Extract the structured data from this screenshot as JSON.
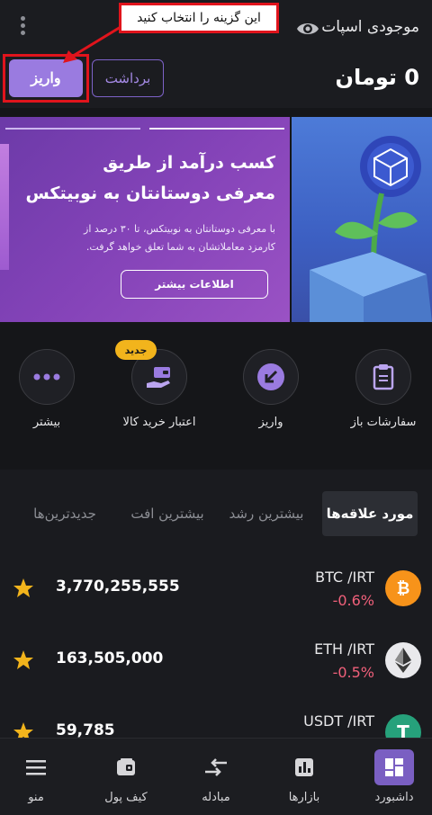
{
  "header": {
    "balance_label": "موجودی اسپات",
    "balance_amount": "0 تومان",
    "deposit_label": "واریز",
    "withdraw_label": "برداشت"
  },
  "annotation": {
    "instruction": "این گزینه را انتخاب کنید",
    "color": "#e0141c"
  },
  "banner": {
    "title_line1": "کسب درآمد از طریق",
    "title_line2": "معرفی دوستانتان به نوبیتکس",
    "desc_line1": "با معرفی دوستانتان به نوبیتکس، تا ۳۰ درصد از",
    "desc_line2": "کارمزد معاملاتشان به شما تعلق خواهد گرفت.",
    "button_label": "اطلاعات بیشتر"
  },
  "quick_actions": [
    {
      "label": "سفارشات باز",
      "icon": "clipboard-icon"
    },
    {
      "label": "واریز",
      "icon": "deposit-arrow-icon"
    },
    {
      "label": "اعتبار خرید کالا",
      "icon": "wallet-hand-icon",
      "badge": "جدید"
    },
    {
      "label": "بیشتر",
      "icon": "more-dots-icon"
    }
  ],
  "market_tabs": [
    {
      "label": "مورد علاقه‌ها",
      "active": true
    },
    {
      "label": "بیشترین رشد",
      "active": false
    },
    {
      "label": "بیشترین افت",
      "active": false
    },
    {
      "label": "جدیدترین‌ها",
      "active": false
    }
  ],
  "coins": [
    {
      "pair": "BTC /IRT",
      "change": "-0.6%",
      "price": "3,770,255,555",
      "icon": "bitcoin-icon",
      "color": "#f7931a"
    },
    {
      "pair": "ETH /IRT",
      "change": "-0.5%",
      "price": "163,505,000",
      "icon": "ethereum-icon",
      "color": "#ffffff"
    },
    {
      "pair": "USDT /IRT",
      "change": "",
      "price": "59,785",
      "icon": "tether-icon",
      "color": "#26a17b"
    }
  ],
  "bottom_nav": [
    {
      "label": "داشبورد",
      "icon": "dashboard-icon",
      "active": true
    },
    {
      "label": "بازارها",
      "icon": "bar-chart-icon",
      "active": false
    },
    {
      "label": "مبادله",
      "icon": "swap-arrows-icon",
      "active": false
    },
    {
      "label": "کیف پول",
      "icon": "wallet-icon",
      "active": false
    },
    {
      "label": "منو",
      "icon": "hamburger-menu-icon",
      "active": false
    }
  ],
  "colors": {
    "accent": "#9a7be0",
    "negative": "#f0607a",
    "badge": "#f2b41c",
    "star": "#f2b41c"
  }
}
